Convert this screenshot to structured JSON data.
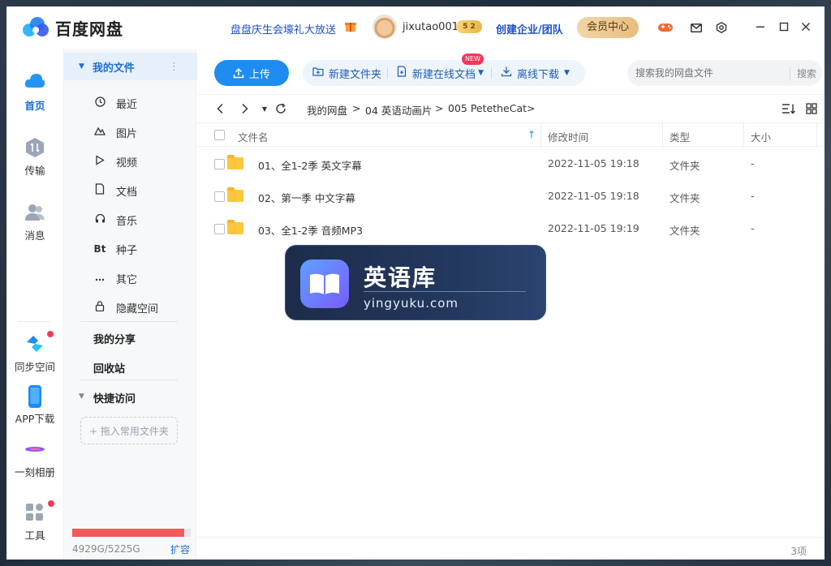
{
  "app": {
    "title": "百度网盘",
    "promo": "盘盘庆生会壕礼大放送",
    "username": "jixutao001",
    "level_badge": "5 2",
    "enterprise": "创建企业/团队",
    "vip": "会员中心"
  },
  "rail": {
    "items": [
      {
        "label": "首页"
      },
      {
        "label": "传输"
      },
      {
        "label": "消息"
      },
      {
        "label": "同步空间"
      },
      {
        "label": "APP下载"
      },
      {
        "label": "一刻相册"
      },
      {
        "label": "工具"
      }
    ]
  },
  "nav": {
    "my_files": "我的文件",
    "items": [
      {
        "label": "最近",
        "icon": "clock-icon"
      },
      {
        "label": "图片",
        "icon": "image-icon"
      },
      {
        "label": "视频",
        "icon": "play-icon"
      },
      {
        "label": "文档",
        "icon": "document-icon"
      },
      {
        "label": "音乐",
        "icon": "headphones-icon"
      },
      {
        "label": "种子",
        "icon": "bt-icon",
        "glyph": "Bt"
      },
      {
        "label": "其它",
        "icon": "more-icon"
      },
      {
        "label": "隐藏空间",
        "icon": "lock-icon"
      }
    ],
    "my_share": "我的分享",
    "recycle": "回收站",
    "quick_access": "快捷访问",
    "drop_hint": "+ 拖入常用文件夹",
    "storage": "4929G/5225G",
    "storage_fraction": 0.943,
    "expand": "扩容"
  },
  "toolbar": {
    "upload": "上传",
    "new_folder": "新建文件夹",
    "new_online_doc": "新建在线文档",
    "new_badge": "NEW",
    "offline_download": "离线下载",
    "search_placeholder": "搜索我的网盘文件",
    "search_button": "搜索"
  },
  "breadcrumb": {
    "items": [
      "我的网盘",
      ">",
      "04 英语动画片",
      ">",
      "005 PetetheCat",
      ">"
    ]
  },
  "table": {
    "headers": {
      "name": "文件名",
      "modified": "修改时间",
      "type": "类型",
      "size": "大小"
    },
    "rows": [
      {
        "name": "01、全1-2季 英文字幕",
        "modified": "2022-11-05 19:18",
        "type": "文件夹",
        "size": "-"
      },
      {
        "name": "02、第一季 中文字幕",
        "modified": "2022-11-05 19:18",
        "type": "文件夹",
        "size": "-"
      },
      {
        "name": "03、全1-2季 音频MP3",
        "modified": "2022-11-05 19:19",
        "type": "文件夹",
        "size": "-"
      }
    ]
  },
  "footer": {
    "count": "3项"
  },
  "watermark": {
    "title": "英语库",
    "url": "yingyuku.com"
  }
}
